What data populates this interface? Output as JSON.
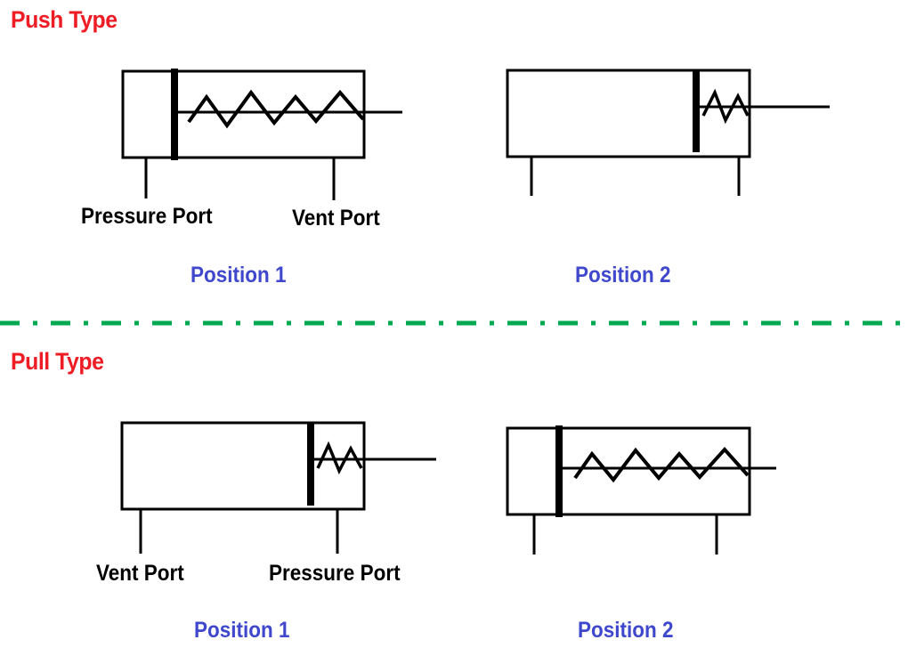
{
  "colors": {
    "section_title": "#ee1c24",
    "position_label": "#3f48cc",
    "divider": "#00a850",
    "line": "#000000"
  },
  "sections": [
    {
      "title": "Push Type",
      "diagrams": [
        {
          "position_label": "Position 1",
          "piston_state": "retracted",
          "spring_state": "extended",
          "spring_coils": 4,
          "ports": [
            {
              "label": "Pressure Port",
              "side": "left"
            },
            {
              "label": "Vent Port",
              "side": "right"
            }
          ]
        },
        {
          "position_label": "Position 2",
          "piston_state": "extended",
          "spring_state": "compressed",
          "spring_coils": 2,
          "ports": [
            {
              "label": "",
              "side": "left"
            },
            {
              "label": "",
              "side": "right"
            }
          ]
        }
      ]
    },
    {
      "title": "Pull Type",
      "diagrams": [
        {
          "position_label": "Position 1",
          "piston_state": "extended",
          "spring_state": "compressed",
          "spring_coils": 2,
          "ports": [
            {
              "label": "Vent Port",
              "side": "left"
            },
            {
              "label": "Pressure Port",
              "side": "right"
            }
          ]
        },
        {
          "position_label": "Position 2",
          "piston_state": "retracted",
          "spring_state": "extended",
          "spring_coils": 4,
          "ports": [
            {
              "label": "",
              "side": "left"
            },
            {
              "label": "",
              "side": "right"
            }
          ]
        }
      ]
    }
  ],
  "divider_style": "dash-dot"
}
